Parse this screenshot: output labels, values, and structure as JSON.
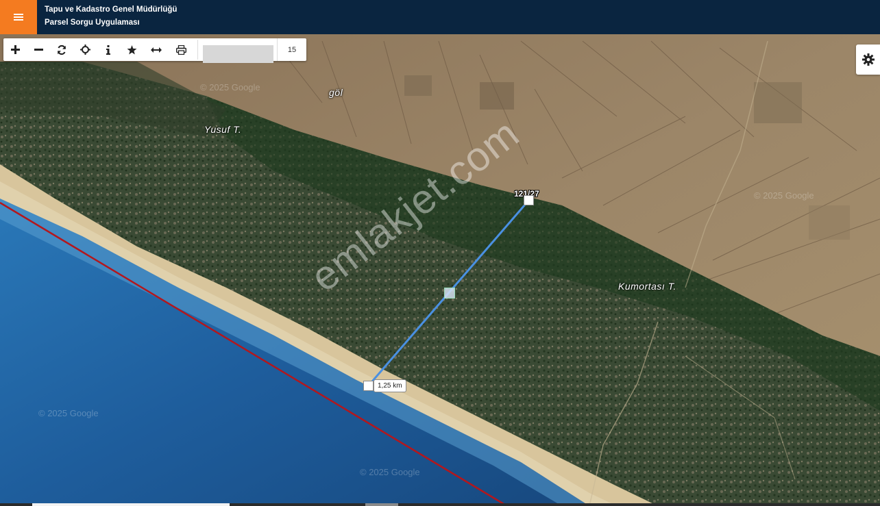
{
  "header": {
    "title_line1": "Tapu ve Kadastro Genel Müdürlüğü",
    "title_line2": "Parsel Sorgu Uygulaması"
  },
  "toolbar": {
    "tools": [
      {
        "name": "zoom-in",
        "icon": "plus-icon"
      },
      {
        "name": "zoom-out",
        "icon": "minus-icon"
      },
      {
        "name": "refresh",
        "icon": "refresh-icon"
      },
      {
        "name": "locate",
        "icon": "crosshair-icon"
      },
      {
        "name": "info",
        "icon": "info-icon"
      },
      {
        "name": "favorite",
        "icon": "star-icon"
      },
      {
        "name": "measure",
        "icon": "arrows-horizontal-icon"
      },
      {
        "name": "print",
        "icon": "printer-icon"
      }
    ],
    "zoom_level": "15"
  },
  "map": {
    "place_labels": {
      "gol": "göl",
      "yusuf": "Yusuf T.",
      "kumortasi": "Kumortası T."
    },
    "parcel_label": "121/27",
    "measurement_label": "1,25 km",
    "copyright": "© 2025 Google",
    "watermark": "emlakjet.com"
  },
  "colors": {
    "header_bg": "#0a2540",
    "menu_accent": "#f47b20",
    "measure_line": "#4a90e2",
    "boundary_line": "#b3171d"
  }
}
